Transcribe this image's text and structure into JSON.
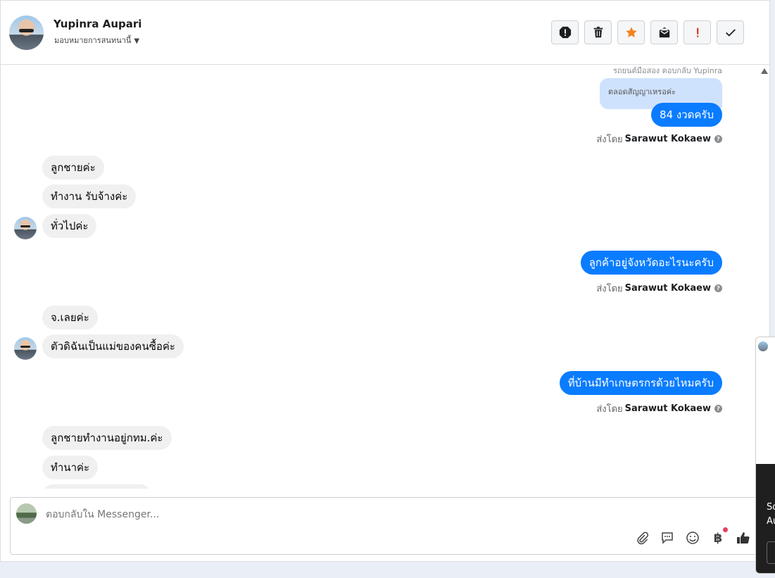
{
  "header": {
    "name": "Yupinra Aupari",
    "assignment": "มอบหมายการสนทนานี้",
    "actions": [
      {
        "icon": "alert-octagon-icon",
        "color": "#1c1e21"
      },
      {
        "icon": "trash-icon",
        "color": "#1c1e21"
      },
      {
        "icon": "star-icon",
        "color": "#f5821f"
      },
      {
        "icon": "mark-unread-icon",
        "color": "#1c1e21"
      },
      {
        "icon": "exclamation-icon",
        "color": "#d93025"
      },
      {
        "icon": "check-icon",
        "color": "#1c1e21"
      }
    ]
  },
  "messages": {
    "reply_meta": "รถยนต์มือสอง ตอบกลับ Yupinra",
    "reply_quote": "ตลอดสัญญาเหรอค่ะ",
    "out_1": "84 งวดครับ",
    "sent_by_prefix": "ส่งโดย",
    "sent_by_name": "Sarawut Kokaew",
    "in_1": "ลูกชายค่ะ",
    "in_2": "ทำงาน รับจ้างค่ะ",
    "in_3": "ทั่วไปค่ะ",
    "out_2": "ลูกค้าอยู่จังหวัดอะไรนะครับ",
    "in_4": "จ.เลยค่ะ",
    "in_5": "ตัวดิฉันเป็นแม่ของคนซื้อค่ะ",
    "out_3": "ที่บ้านมีทำเกษตรกรด้วยไหมครับ",
    "in_6": "ลูกชายทำงานอยู่กทม.ค่ะ",
    "in_7": "ทำนาค่ะ"
  },
  "composer": {
    "placeholder": "ตอบกลับใน Messenger...",
    "tools": [
      "paperclip-icon",
      "comment-icon",
      "smiley-icon",
      "baht-icon",
      "thumbs-up-icon"
    ],
    "baht_symbol": "฿"
  },
  "popup": {
    "text_line1": "So",
    "text_line2": "Au"
  }
}
